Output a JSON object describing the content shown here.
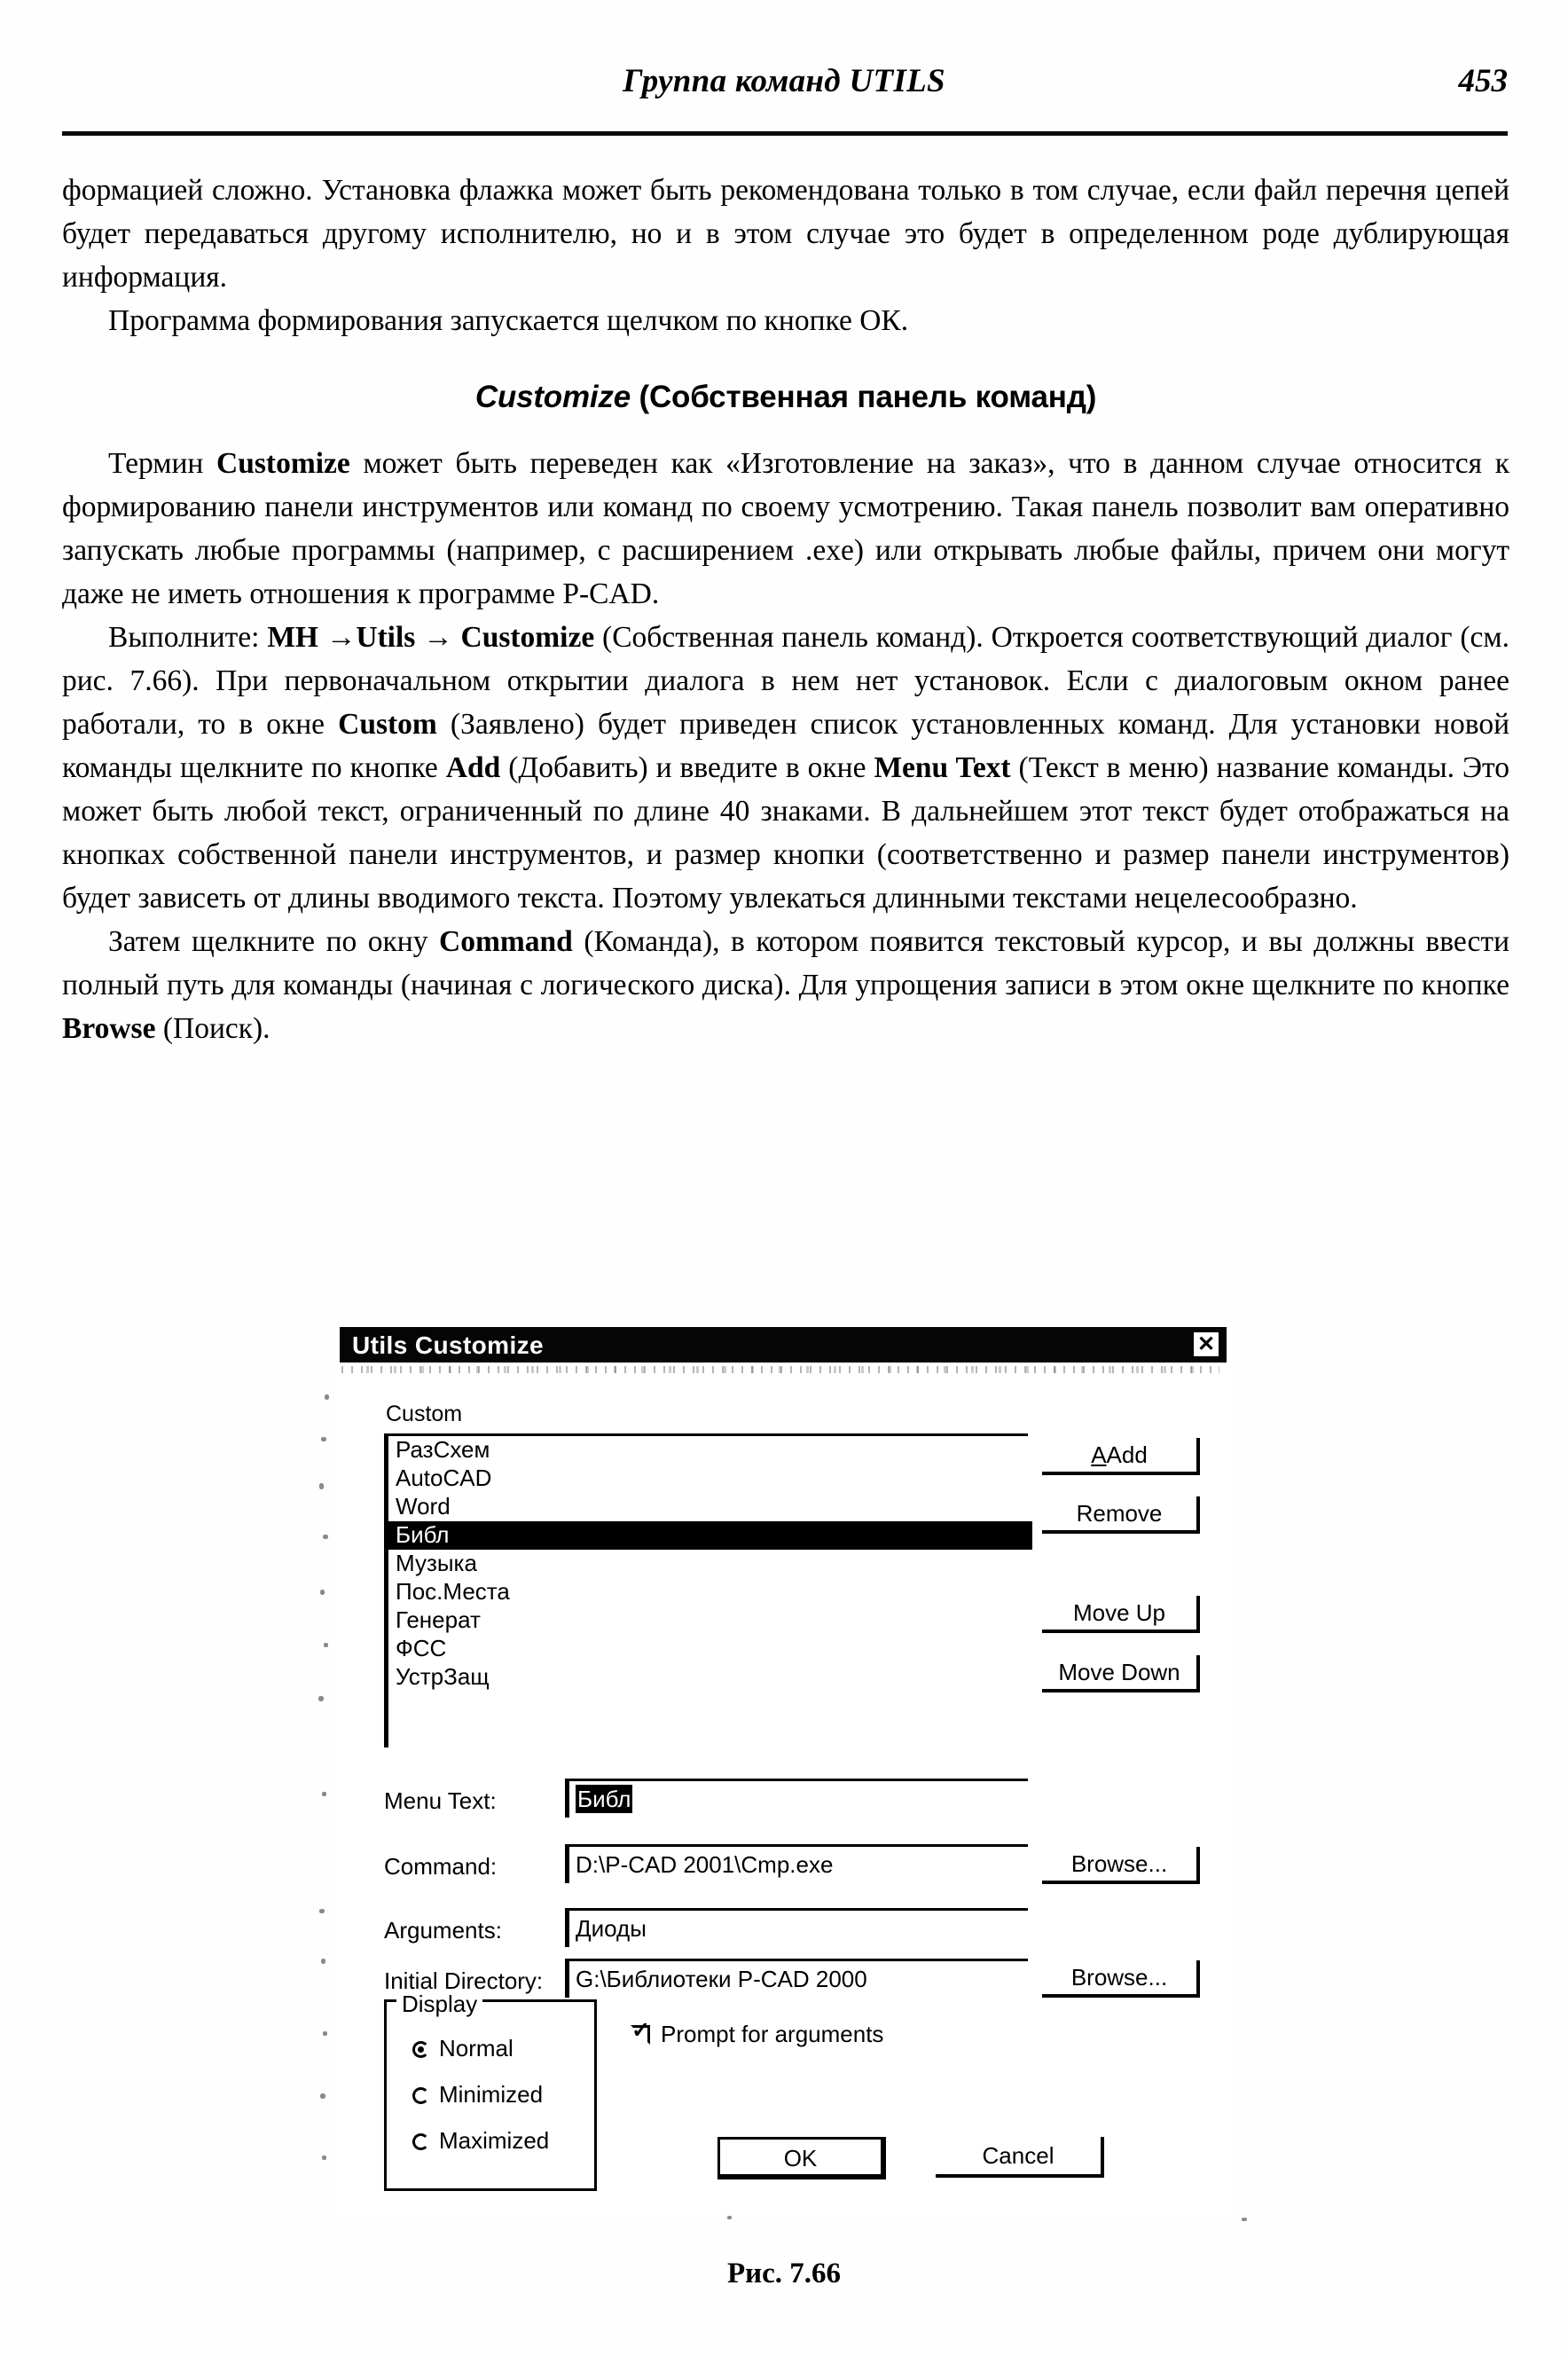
{
  "header": {
    "running_title": "Группа команд UTILS",
    "page_number": "453"
  },
  "body": {
    "para1": "формацией сложно. Установка флажка может быть рекомендована только в том случае, если файл перечня цепей будет передаваться другому исполнителю, но и в этом случае это будет в определенном роде дублирующая информация.",
    "para2": "Программа формирования запускается щелчком по кнопке ОК.",
    "section_heading_latin": "Customize",
    "section_heading_rest": " (Собственная панель команд)",
    "para3_a": "Термин ",
    "para3_bold": "Customize",
    "para3_b": " может быть переведен как «Изготовление на заказ», что в данном случае относится к формированию панели инструментов или команд по своему усмотрению. Такая панель позволит вам оперативно запускать любые программы (например, с расширением .exe) или открывать любые файлы, причем они могут даже не иметь отношения к программе P-CAD.",
    "para4_a": "Выполните: ",
    "para4_b1": "МН →Utils → ",
    "para4_b2": "Customize",
    "para4_c": " (Собственная панель команд). Откроется соответствующий диалог (см. рис. 7.66). При первоначальном открытии диалога в нем нет установок. Если с диалоговым окном ранее работали, то в окне ",
    "para4_b3": "Custom",
    "para4_d": " (Заявлено) будет приведен список установленных команд. Для установки новой команды щелкните по кнопке ",
    "para4_b4": "Add",
    "para4_e": " (Добавить) и введите в окне ",
    "para4_b5": "Menu Text",
    "para4_f": " (Текст в меню) название команды. Это может быть любой текст, ограниченный по длине 40 знаками. В дальнейшем этот текст будет отображаться на кнопках собственной панели инструментов, и размер кнопки (соответственно и размер панели инструментов) будет зависеть от длины вводимого текста. Поэтому увлекаться длинными текстами нецелесообразно.",
    "para5_a": "Затем щелкните по окну ",
    "para5_b1": "Command",
    "para5_b": " (Команда), в котором появится текстовый курсор, и вы должны ввести полный путь для команды (начиная с логического диска). Для упрощения записи в этом окне щелкните по кнопке ",
    "para5_b2": "Browse",
    "para5_c": " (Поиск)."
  },
  "figure": {
    "caption": "Рис. 7.66"
  },
  "dialog": {
    "title": "Utils Customize",
    "close_label": "✕",
    "custom_label": "Custom",
    "list_items": [
      {
        "label": "РазСхем",
        "selected": false
      },
      {
        "label": "AutoCAD",
        "selected": false
      },
      {
        "label": "Word",
        "selected": false
      },
      {
        "label": "Библ",
        "selected": true
      },
      {
        "label": "Музыка",
        "selected": false
      },
      {
        "label": "Пос.Места",
        "selected": false
      },
      {
        "label": "Генерат",
        "selected": false
      },
      {
        "label": "ФСС",
        "selected": false
      },
      {
        "label": "УстрЗащ",
        "selected": false
      }
    ],
    "buttons": {
      "add": "Add",
      "add_accel": "A",
      "remove": "Remove",
      "remove_accel": "R",
      "move_up": "Move Up",
      "move_up_accel": "U",
      "move_down": "Move Down",
      "move_down_accel": "D",
      "browse_command": "Browse...",
      "browse_command_accel": "B",
      "browse_initial_dir": "Browse...",
      "browse_initial_dir_accel": "w",
      "ok": "OK",
      "cancel": "Cancel"
    },
    "fields": {
      "menu_text_label": "Menu Text:",
      "menu_text_accel": "M",
      "menu_text_value": "Библ",
      "command_label": "Command:",
      "command_accel": "C",
      "command_value": "D:\\P-CAD 2001\\Cmp.exe",
      "arguments_label": "Arguments:",
      "arguments_accel": "A",
      "arguments_value": "Диоды",
      "initial_directory_label": "Initial Directory:",
      "initial_directory_accel": "I",
      "initial_directory_value": "G:\\Библиотеки P-CAD 2000"
    },
    "display_group": {
      "title": "Display",
      "options": [
        {
          "label": "Normal",
          "accel": "N",
          "selected": true
        },
        {
          "label": "Minimized",
          "accel": "z",
          "selected": false
        },
        {
          "label": "Maximized",
          "accel": "x",
          "selected": false
        }
      ]
    },
    "prompt_checkbox": {
      "label": "Prompt for arguments",
      "accel": "P",
      "checked": true
    },
    "colors": {
      "title_bar": "#0b0b0b",
      "selection": "#050505",
      "background": "#ffffff",
      "text": "#000000"
    }
  }
}
